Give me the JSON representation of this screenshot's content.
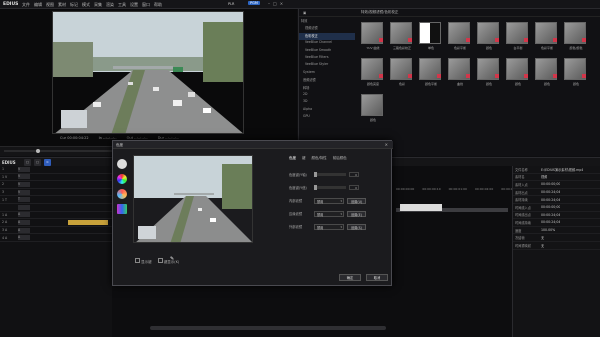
{
  "app": {
    "logo": "EDIUS",
    "menus": [
      "文件",
      "编辑",
      "视图",
      "素材",
      "标记",
      "模式",
      "采集",
      "渲染",
      "工具",
      "设置",
      "窗口",
      "帮助"
    ],
    "plr": "PLR",
    "pgm": "PGM"
  },
  "player": {
    "timecode_labels": [
      "Cur 00:00:04:22",
      "In --:--:--:--",
      "Out --:--:--:--",
      "Dur --:--:--:--"
    ]
  },
  "effects": {
    "path": "特效/视频滤镜/色彩校正",
    "tree": [
      "特效",
      "视频滤镜",
      "色彩校正",
      "VeeBlue Channel",
      "VeeBlue Smooth",
      "VeeBlue Filters",
      "VeeBlue Styler",
      "System",
      "音频滤镜",
      "转场",
      "2D",
      "3D",
      "Alpha",
      "GPU"
    ],
    "selected_index": 2,
    "tiles": [
      "YUV 曲线",
      "三路色彩校正",
      "单色",
      "色彩平衡",
      "颜色",
      "白平衡",
      "色彩平衡",
      "颜色/颜色",
      "颜色亮度",
      "色彩",
      "颜色平衡",
      "曲线",
      "颜色",
      "颜色",
      "颜色",
      "颜色",
      "颜色"
    ]
  },
  "timeline": {
    "logo": "EDIUS",
    "tool_labels": [
      "□",
      "□",
      "C"
    ],
    "tracks": [
      {
        "n": "1",
        "k": "V"
      },
      {
        "n": "1 V",
        "k": "V"
      },
      {
        "n": "2",
        "k": "V"
      },
      {
        "n": "3",
        "k": "V"
      },
      {
        "n": "1 T",
        "k": "T"
      },
      {
        "n": "",
        "k": ""
      },
      {
        "n": "1 A",
        "k": "A"
      },
      {
        "n": "2 A",
        "k": "A"
      },
      {
        "n": "3 A",
        "k": "A"
      },
      {
        "n": "4 A",
        "k": "A"
      }
    ],
    "ruler": [
      "00:00:00:00",
      "00:00:00:10",
      "00:00:01:00",
      "00:00:02:00",
      "00:00:03:00"
    ]
  },
  "properties": [
    {
      "k": "文件名称",
      "v": "E:\\EDIUS演示素材\\视频.mp4"
    },
    {
      "k": "素材名",
      "v": "视频"
    },
    {
      "k": "素材入点",
      "v": "00:00:00;00"
    },
    {
      "k": "素材出点",
      "v": "00:00:24;04"
    },
    {
      "k": "素材持续",
      "v": "00:00:24;04"
    },
    {
      "k": "时间线入点",
      "v": "00:00:00;00"
    },
    {
      "k": "时间线出点",
      "v": "00:00:24;04"
    },
    {
      "k": "时间线持续",
      "v": "00:00:24;04"
    },
    {
      "k": "速度",
      "v": "100.00%"
    },
    {
      "k": "冻结帧",
      "v": "无"
    },
    {
      "k": "时间重映射",
      "v": "无"
    }
  ],
  "dialog": {
    "title": "色度",
    "tabs": [
      "色度",
      "键",
      "颜色/特性",
      "前后颜色"
    ],
    "rows": [
      {
        "label": "色度键(Y轴)",
        "type": "slider",
        "value": "0"
      },
      {
        "label": "色度键(Y值)",
        "type": "slider",
        "value": "0"
      },
      {
        "label": "内部滤镜",
        "type": "select",
        "value": "禁用",
        "button": "设置(U)"
      },
      {
        "label": "边缘滤镜",
        "type": "select",
        "value": "禁用",
        "button": "设置(E)"
      },
      {
        "label": "外部滤镜",
        "type": "select",
        "value": "禁用",
        "button": "设置(S)"
      }
    ],
    "checks": [
      "显示键",
      "键显示(K)"
    ],
    "ok": "确定",
    "cancel": "取消"
  }
}
